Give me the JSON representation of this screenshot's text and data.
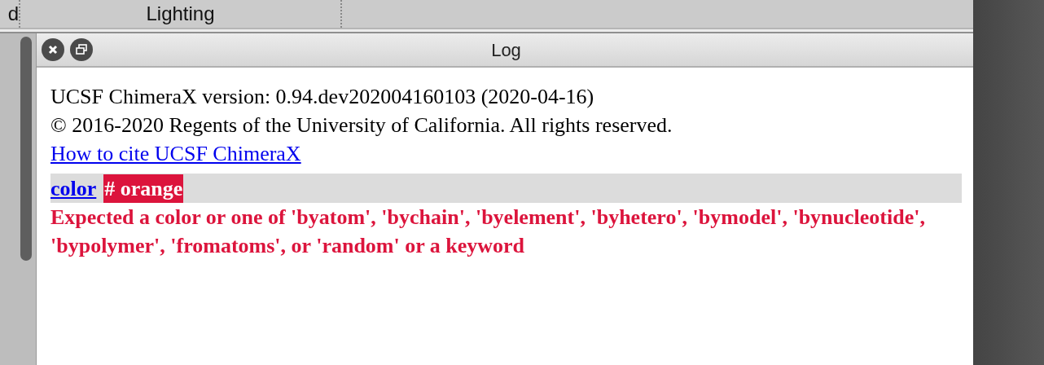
{
  "tabs": [
    {
      "label": "d"
    },
    {
      "label": "Lighting"
    }
  ],
  "log": {
    "title": "Log",
    "info_lines": [
      "UCSF ChimeraX version: 0.94.dev202004160103 (2020-04-16)",
      "© 2016-2020 Regents of the University of California. All rights reserved."
    ],
    "cite_link": "How to cite UCSF ChimeraX",
    "command": {
      "name": "color",
      "argument": "# orange"
    },
    "error": "Expected a color or one of 'byatom', 'bychain', 'byelement', 'byhetero', 'bymodel', 'bynucleotide', 'bypolymer', 'fromatoms', or 'random' or a keyword"
  }
}
